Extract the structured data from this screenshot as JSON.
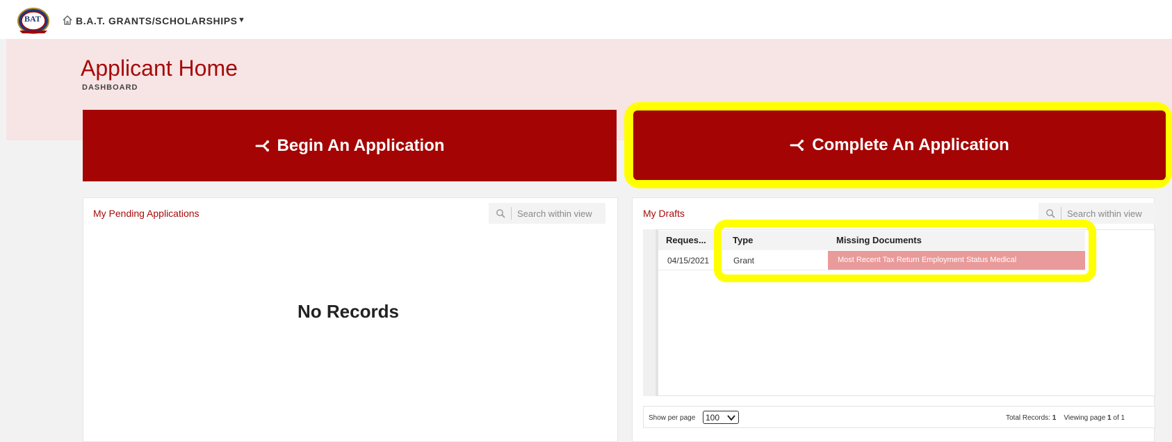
{
  "header": {
    "app_title": "B.A.T. GRANTS/SCHOLARSHIPS",
    "logo_text": "BAT"
  },
  "page": {
    "title": "Applicant Home",
    "subtitle": "DASHBOARD"
  },
  "actions": {
    "begin_label": "Begin An Application",
    "complete_label": "Complete An Application"
  },
  "pending": {
    "title": "My Pending Applications",
    "search_placeholder": "Search within view",
    "empty_text": "No Records"
  },
  "drafts": {
    "title": "My Drafts",
    "search_placeholder": "Search within view",
    "columns": [
      "Reques...",
      "Type",
      "Missing Documents"
    ],
    "rows": [
      {
        "requested": "04/15/2021",
        "type": "Grant",
        "missing": "Most Recent Tax Return Employment Status Medical"
      }
    ],
    "footer": {
      "show_per_page_label": "Show per page",
      "per_page_value": "100",
      "total_label": "Total Records:",
      "total_value": "1",
      "viewing_label": "Viewing page",
      "page_current": "1",
      "page_of": "of 1"
    }
  },
  "colors": {
    "brand_red": "#a50404",
    "highlight_yellow": "#ffff00",
    "missing_cell": "#e99a9a",
    "banner_pink": "#f7e4e4"
  }
}
